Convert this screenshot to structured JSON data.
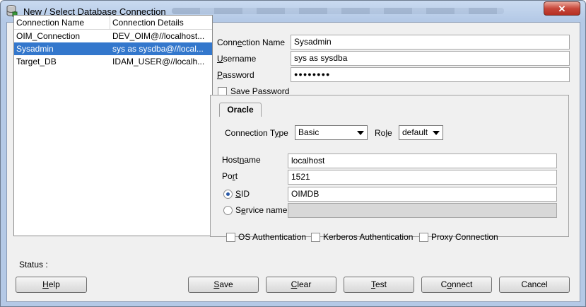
{
  "window": {
    "title": "New / Select Database Connection",
    "close_glyph": "✕"
  },
  "list": {
    "headers": [
      "Connection Name",
      "Connection Details"
    ],
    "rows": [
      {
        "name": "OIM_Connection",
        "details": "DEV_OIM@//localhost..."
      },
      {
        "name": "Sysadmin",
        "details": "sys as sysdba@//local...",
        "selected": true
      },
      {
        "name": "Target_DB",
        "details": "IDAM_USER@//localh..."
      }
    ]
  },
  "form": {
    "connection_name": {
      "label_pre": "Conn",
      "label_u": "e",
      "label_post": "ction Name",
      "value": "Sysadmin"
    },
    "username": {
      "label_pre": "",
      "label_u": "U",
      "label_post": "sername",
      "value": "sys as sysdba"
    },
    "password": {
      "label_pre": "",
      "label_u": "P",
      "label_post": "assword",
      "value": "●●●●●●●●"
    },
    "save_password": {
      "label_pre": "Sa",
      "label_u": "v",
      "label_post": "e Password",
      "checked": false
    }
  },
  "tab": {
    "label": "Oracle"
  },
  "oracle": {
    "connection_type": {
      "label_pre": "Connection T",
      "label_u": "y",
      "label_post": "pe",
      "value": "Basic"
    },
    "role": {
      "label_pre": "Ro",
      "label_u": "l",
      "label_post": "e",
      "value": "default"
    },
    "hostname": {
      "label_pre": "Host",
      "label_u": "n",
      "label_post": "ame",
      "value": "localhost"
    },
    "port": {
      "label_pre": "Po",
      "label_u": "r",
      "label_post": "t",
      "value": "1521"
    },
    "sid": {
      "label_pre": "",
      "label_u": "S",
      "label_post": "ID",
      "value": "OIMDB",
      "selected": true
    },
    "service_name": {
      "label_pre": "S",
      "label_u": "e",
      "label_post": "rvice name",
      "value": "",
      "selected": false
    },
    "auth": {
      "os": "OS Authentication",
      "kerberos": "Kerberos Authentication",
      "proxy": "Proxy Connection"
    }
  },
  "status": {
    "label": "Status :",
    "text": ""
  },
  "buttons": {
    "help": {
      "u": "H",
      "rest": "elp"
    },
    "save": {
      "u": "S",
      "rest": "ave"
    },
    "clear": {
      "u": "C",
      "rest": "lear"
    },
    "test": {
      "u": "T",
      "rest": "est"
    },
    "connect": {
      "pre": "C",
      "u": "o",
      "rest": "nnect"
    },
    "cancel": {
      "label": "Cancel"
    }
  },
  "colors": {
    "selection": "#3377cc",
    "title_gradient": "#c9daf0",
    "close_button": "#c8473a"
  },
  "icons": {
    "title": "database-connection-icon",
    "close": "close-icon",
    "dropdown": "chevron-down-icon"
  }
}
